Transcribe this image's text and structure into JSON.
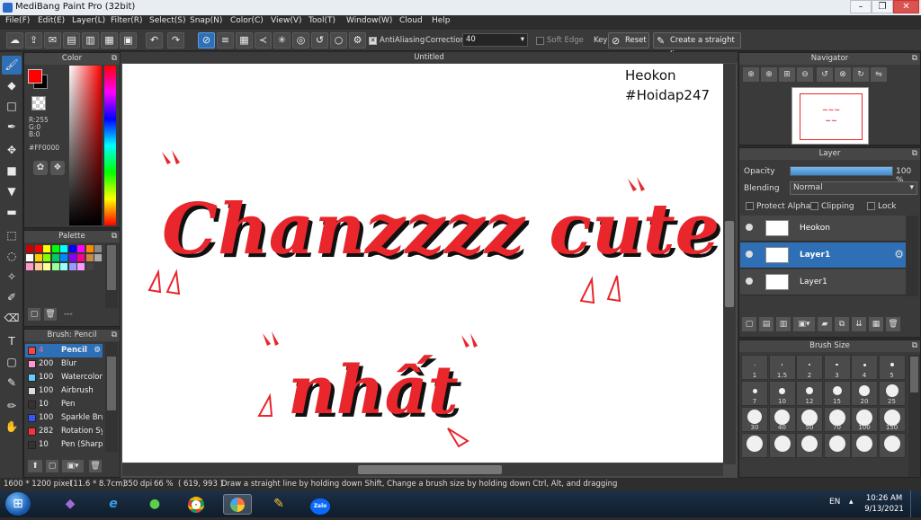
{
  "window": {
    "title": "MediBang Paint Pro (32bit)"
  },
  "menu": [
    "File(F)",
    "Edit(E)",
    "Layer(L)",
    "Filter(R)",
    "Select(S)",
    "Snap(N)",
    "Color(C)",
    "View(V)",
    "Tool(T)",
    "Window(W)",
    "Cloud",
    "Help"
  ],
  "toolbar": {
    "antialiasing_label": "AntiAliasing",
    "correction_label": "Correction",
    "correction_value": "40",
    "soft_edge_label": "Soft Edge",
    "key_label": "Key",
    "reset_label": "Reset",
    "straight_line_label": "Create a straight line"
  },
  "color_panel": {
    "title": "Color",
    "r": "R:255",
    "g": "G:0",
    "b": "B:0",
    "hex": "#FF0000",
    "fg": "#ff0000",
    "bg": "#000000"
  },
  "palette_panel": {
    "title": "Palette",
    "count": "---",
    "swatches": [
      "#cc0000",
      "#ff0000",
      "#ffff00",
      "#00ff00",
      "#00ffff",
      "#0000ff",
      "#ff00ff",
      "#ff8800",
      "#888888",
      "#ffffff",
      "#ffcc00",
      "#88ff00",
      "#00cc66",
      "#0088ff",
      "#8800ff",
      "#ff0088",
      "#cc8844",
      "#aaaaaa",
      "#ff99cc",
      "#ffcc99",
      "#ffff99",
      "#99ff99",
      "#99ffff",
      "#9999ff",
      "#ff99ff",
      "#444444"
    ]
  },
  "brush_panel": {
    "title": "Brush: Pencil",
    "items": [
      {
        "size": "4",
        "name": "Pencil",
        "color": "#ff4444",
        "selected": true
      },
      {
        "size": "200",
        "name": "Blur",
        "color": "#ff99cc"
      },
      {
        "size": "100",
        "name": "Watercolor",
        "color": "#66ccff"
      },
      {
        "size": "100",
        "name": "Airbrush",
        "color": "#dddddd"
      },
      {
        "size": "10",
        "name": "Pen",
        "color": "#333333"
      },
      {
        "size": "100",
        "name": "Sparkle Bru",
        "color": "#3355ff"
      },
      {
        "size": "282",
        "name": "Rotation Sy",
        "color": "#ff3333"
      },
      {
        "size": "10",
        "name": "Pen (Sharp",
        "color": "#333333"
      }
    ]
  },
  "canvas": {
    "tab_title": "Untitled",
    "watermark_line1": "Heokon",
    "watermark_line2": "#Hoidap247",
    "text_line1": "Chanzzzz cute",
    "text_line2": "nhất"
  },
  "navigator": {
    "title": "Navigator"
  },
  "layer_panel": {
    "title": "Layer",
    "opacity_label": "Opacity",
    "opacity_value": "100 %",
    "opacity_fraction": 1.0,
    "blending_label": "Blending",
    "blending_value": "Normal",
    "protect_alpha": "Protect Alpha",
    "clipping": "Clipping",
    "lock": "Lock",
    "layers": [
      {
        "name": "Heokon",
        "selected": false
      },
      {
        "name": "Layer1",
        "selected": true
      },
      {
        "name": "Layer1",
        "selected": false
      }
    ]
  },
  "brush_size_panel": {
    "title": "Brush Size",
    "sizes": [
      "1",
      "1.5",
      "2",
      "3",
      "4",
      "5",
      "7",
      "10",
      "12",
      "15",
      "20",
      "25",
      "30",
      "40",
      "50",
      "70",
      "100",
      "150",
      "",
      "",
      "",
      "",
      "",
      ""
    ]
  },
  "status": {
    "size": "1600 * 1200 pixel",
    "cm": "(11.6 * 8.7cm)",
    "dpi": "350 dpi",
    "zoom": "66 %",
    "coords": "( 619, 993 )",
    "hint": "Draw a straight line by holding down Shift, Change a brush size by holding down Ctrl, Alt, and dragging"
  },
  "taskbar": {
    "lang": "EN",
    "time": "10:26 AM",
    "date": "9/13/2021",
    "zalo": "Zalo"
  }
}
